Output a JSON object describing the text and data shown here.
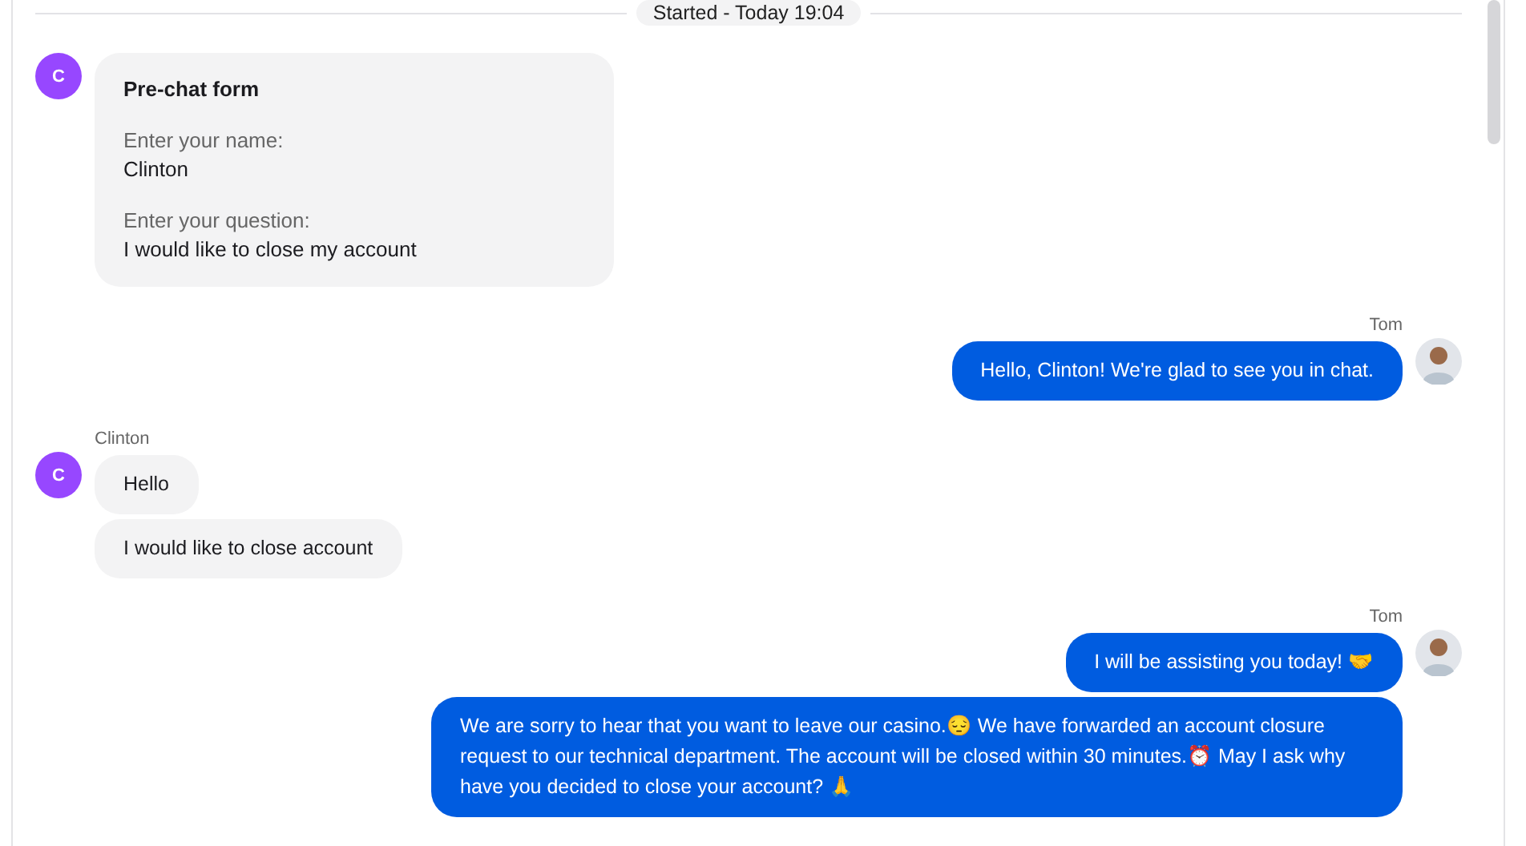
{
  "separator": {
    "label": "Started - Today 19:04"
  },
  "messages": [
    {
      "kind": "form",
      "from_agent": false,
      "avatar": "C",
      "title": "Pre-chat form",
      "fields": [
        {
          "label": "Enter your name:",
          "value": "Clinton"
        },
        {
          "label": "Enter your question:",
          "value": "I would like to close my account"
        }
      ]
    },
    {
      "kind": "text",
      "from_agent": true,
      "sender": "Tom",
      "bubbles": [
        "Hello, Clinton! We're glad to see you in chat."
      ]
    },
    {
      "kind": "text",
      "from_agent": false,
      "sender": "Clinton",
      "avatar": "C",
      "bubbles": [
        "Hello",
        "I would like to close account"
      ]
    },
    {
      "kind": "text",
      "from_agent": true,
      "sender": "Tom",
      "bubbles": [
        "I will be assisting you today! 🤝",
        "We are sorry to hear that you want to leave our casino.😔 We have forwarded an account closure request to our technical department. The account will be closed within 30 minutes.⏰ May I ask why have you decided to close your account? 🙏"
      ]
    }
  ]
}
